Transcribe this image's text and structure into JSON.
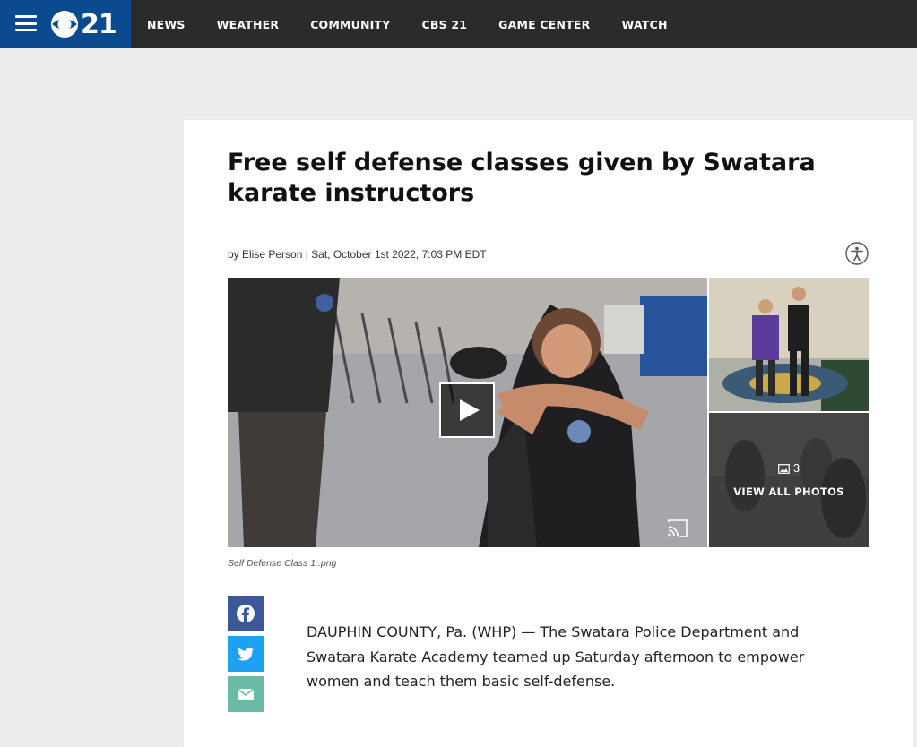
{
  "header": {
    "logo_text": "21",
    "nav": [
      "NEWS",
      "WEATHER",
      "COMMUNITY",
      "CBS 21",
      "GAME CENTER",
      "WATCH"
    ],
    "brand_color": "#0b4a8f",
    "bar_color": "#2b2b2b"
  },
  "article": {
    "title": "Free self defense classes given by Swatara karate instructors",
    "byline": "by Elise Person | Sat, October 1st 2022, 7:03 PM EDT",
    "media": {
      "photo_count": "3",
      "view_all_label": "VIEW ALL PHOTOS",
      "caption": "Self Defense Class 1 .png"
    },
    "share": {
      "facebook_color": "#3b5998",
      "twitter_color": "#1da1f2",
      "email_color": "#6bbaa6"
    },
    "body": "DAUPHIN COUNTY, Pa. (WHP) — The Swatara Police Department and Swatara Karate Academy teamed up Saturday afternoon to empower women and teach them basic self-defense."
  }
}
